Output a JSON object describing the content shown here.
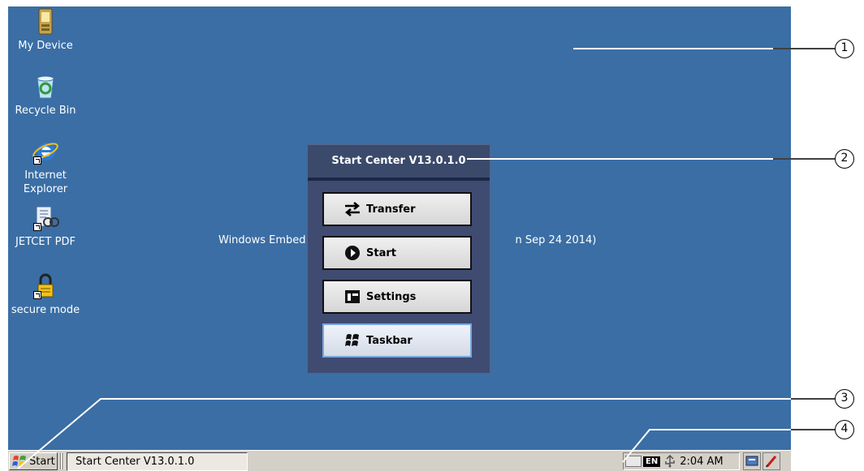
{
  "desktop": {
    "background": "#3a6ea5",
    "icons": [
      {
        "label": "My Device",
        "icon": "pda-icon"
      },
      {
        "label": "Recycle Bin",
        "icon": "recycle-bin-icon"
      },
      {
        "label": "Internet Explorer",
        "icon": "internet-explorer-icon"
      },
      {
        "label": "JETCET PDF",
        "icon": "jetcet-pdf-icon"
      },
      {
        "label": "secure mode",
        "icon": "lock-icon"
      }
    ],
    "watermark_left": "Windows Embed",
    "watermark_right": "n Sep 24 2014)"
  },
  "start_center": {
    "title": "Start Center V13.0.1.0",
    "buttons": [
      {
        "label": "Transfer",
        "icon": "transfer-arrows-icon"
      },
      {
        "label": "Start",
        "icon": "play-icon"
      },
      {
        "label": "Settings",
        "icon": "settings-window-icon"
      },
      {
        "label": "Taskbar",
        "icon": "windows-flag-icon"
      }
    ]
  },
  "taskbar": {
    "start_label": "Start",
    "task_label": "Start Center V13.0.1.0",
    "lang": "EN",
    "clock": "2:04 AM"
  },
  "callouts": [
    "1",
    "2",
    "3",
    "4"
  ]
}
